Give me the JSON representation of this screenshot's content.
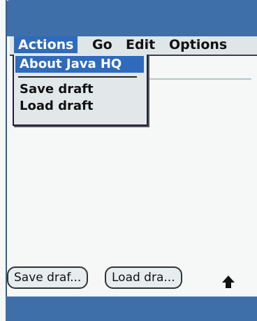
{
  "menubar": {
    "items": [
      {
        "label": "Actions"
      },
      {
        "label": "Go"
      },
      {
        "label": "Edit"
      },
      {
        "label": "Options"
      }
    ]
  },
  "dropdown": {
    "items": [
      {
        "label": "About Java HQ"
      },
      {
        "label": "Save draft"
      },
      {
        "label": "Load draft"
      }
    ]
  },
  "buttons": {
    "save_label": "Save draf...",
    "load_label": "Load dra..."
  },
  "icons": {
    "up_arrow": "up-arrow-icon"
  },
  "colors": {
    "accent": "#2f6bbd",
    "bar": "#3f6fa8"
  }
}
